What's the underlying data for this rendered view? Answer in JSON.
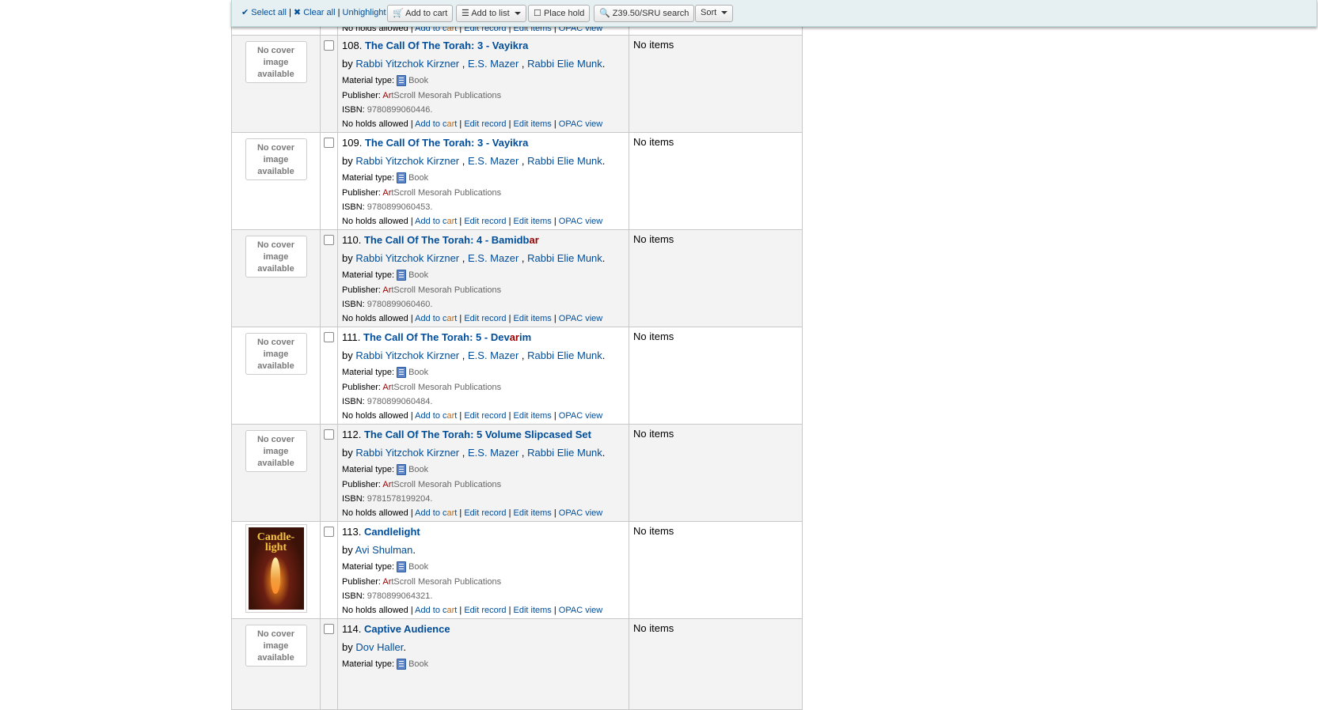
{
  "toolbar": {
    "select_all": "Select all",
    "clear_all": "Clear all",
    "unhighlight": "Unhighlight",
    "add_to_cart": "Add to cart",
    "add_to_list": "Add to list",
    "place_hold": "Place hold",
    "z3950": "Z39.50/SRU search",
    "sort": "Sort"
  },
  "top_partial": {
    "holds": "No holds allowed |",
    "add_to_cart_pre": "Add to c",
    "add_to_cart_hl": "ar",
    "add_to_cart_post": "t",
    "edit_record": "Edit record",
    "edit_items": "Edit items",
    "opac_view": "OPAC view"
  },
  "labels": {
    "no_cover": "No cover image available",
    "by": "by",
    "material_type": "Material type:",
    "publisher": "Publisher:",
    "isbn": "ISBN:",
    "no_holds": "No holds allowed |",
    "add_to_cart_pre": "Add to c",
    "add_to_cart_hl": "ar",
    "add_to_cart_post": "t",
    "edit_record": "Edit record",
    "edit_items": "Edit items",
    "opac_view": "OPAC view",
    "no_items": "No items",
    "material_value": "Book",
    "publisher_hl": "Ar",
    "publisher_rest": "tScroll Mesorah Publications"
  },
  "results": [
    {
      "num": "108.",
      "title_pre": "The Call Of The Torah: 3 - Vayikra",
      "title_hl": "",
      "title_post": "",
      "authors": [
        "Rabbi Yitzchok Kirzner",
        "E.S. Mazer",
        "Rabbi Elie Munk"
      ],
      "isbn": "9780899060446."
    },
    {
      "num": "109.",
      "title_pre": "The Call Of The Torah: 3 - Vayikra",
      "title_hl": "",
      "title_post": "",
      "authors": [
        "Rabbi Yitzchok Kirzner",
        "E.S. Mazer",
        "Rabbi Elie Munk"
      ],
      "isbn": "9780899060453."
    },
    {
      "num": "110.",
      "title_pre": "The Call Of The Torah: 4 - Bamidb",
      "title_hl": "ar",
      "title_post": "",
      "authors": [
        "Rabbi Yitzchok Kirzner",
        "E.S. Mazer",
        "Rabbi Elie Munk"
      ],
      "isbn": "9780899060460."
    },
    {
      "num": "111.",
      "title_pre": "The Call Of The Torah: 5 - Dev",
      "title_hl": "ar",
      "title_post": "im",
      "authors": [
        "Rabbi Yitzchok Kirzner",
        "E.S. Mazer",
        "Rabbi Elie Munk"
      ],
      "isbn": "9780899060484."
    },
    {
      "num": "112.",
      "title_pre": "The Call Of The Torah: 5 Volume Slipcased Set",
      "title_hl": "",
      "title_post": "",
      "authors": [
        "Rabbi Yitzchok Kirzner",
        "E.S. Mazer",
        "Rabbi Elie Munk"
      ],
      "isbn": "9781578199204."
    },
    {
      "num": "113.",
      "title_pre": "Candlelight",
      "title_hl": "",
      "title_post": "",
      "authors": [
        "Avi Shulman"
      ],
      "isbn": "9780899064321.",
      "cover_text": "Candle-light"
    },
    {
      "num": "114.",
      "title_pre": "Captive Audience",
      "title_hl": "",
      "title_post": "",
      "authors": [
        "Dov Haller"
      ],
      "isbn": ""
    }
  ],
  "colors": {
    "link": "#004d99",
    "highlight": "#990000",
    "toolbar_bg": "#e6f0f2"
  }
}
